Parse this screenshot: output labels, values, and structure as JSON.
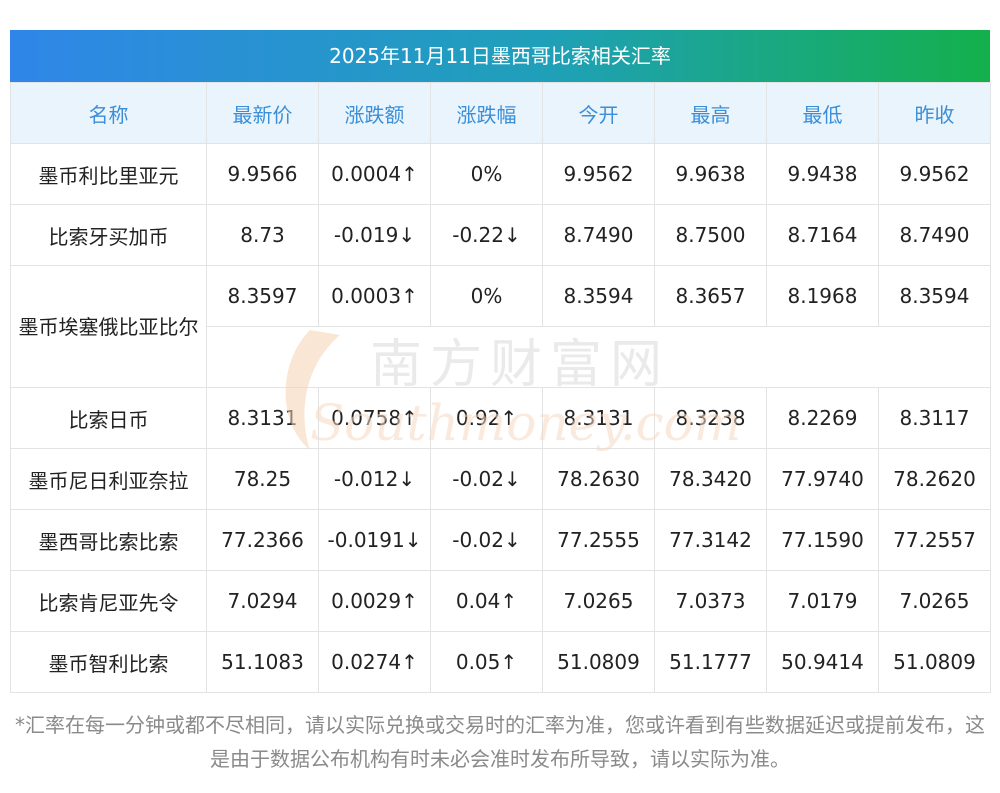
{
  "title": "2025年11月11日墨西哥比索相关汇率",
  "headers": [
    "名称",
    "最新价",
    "涨跌额",
    "涨跌幅",
    "今开",
    "最高",
    "最低",
    "昨收"
  ],
  "rows": [
    {
      "name": "墨币利比里亚元",
      "latest": "9.9566",
      "change": "0.0004↑",
      "pct": "0%",
      "open": "9.9562",
      "high": "9.9638",
      "low": "9.9438",
      "prev": "9.9562"
    },
    {
      "name": "比索牙买加币",
      "latest": "8.73",
      "change": "-0.019↓",
      "pct": "-0.22↓",
      "open": "8.7490",
      "high": "8.7500",
      "low": "8.7164",
      "prev": "8.7490"
    },
    {
      "name": "墨币埃塞俄比亚比尔",
      "latest": "8.3597",
      "change": "0.0003↑",
      "pct": "0%",
      "open": "8.3594",
      "high": "8.3657",
      "low": "8.1968",
      "prev": "8.3594"
    },
    {
      "name": "比索日币",
      "latest": "8.3131",
      "change": "0.0758↑",
      "pct": "0.92↑",
      "open": "8.3131",
      "high": "8.3238",
      "low": "8.2269",
      "prev": "8.3117"
    },
    {
      "name": "墨币尼日利亚奈拉",
      "latest": "78.25",
      "change": "-0.012↓",
      "pct": "-0.02↓",
      "open": "78.2630",
      "high": "78.3420",
      "low": "77.9740",
      "prev": "78.2620"
    },
    {
      "name": "墨西哥比索比索",
      "latest": "77.2366",
      "change": "-0.0191↓",
      "pct": "-0.02↓",
      "open": "77.2555",
      "high": "77.3142",
      "low": "77.1590",
      "prev": "77.2557"
    },
    {
      "name": "比索肯尼亚先令",
      "latest": "7.0294",
      "change": "0.0029↑",
      "pct": "0.04↑",
      "open": "7.0265",
      "high": "7.0373",
      "low": "7.0179",
      "prev": "7.0265"
    },
    {
      "name": "墨币智利比索",
      "latest": "51.1083",
      "change": "0.0274↑",
      "pct": "0.05↑",
      "open": "51.0809",
      "high": "51.1777",
      "low": "50.9414",
      "prev": "51.0809"
    }
  ],
  "watermark": {
    "cn": "南方财富网",
    "en": "Southmoney.com"
  },
  "footer": "*汇率在每一分钟或都不尽相同，请以实际兑换或交易时的汇率为准，您或许看到有些数据延迟或提前发布，这是由于数据公布机构有时未必会准时发布所导致，请以实际为准。",
  "colors": {
    "up": "#e8262b",
    "down": "#1f9e2c",
    "header_text": "#3a8fd8",
    "header_bg": "#eaf4fd",
    "title_start": "#2f86e8",
    "title_end": "#14b04c"
  }
}
